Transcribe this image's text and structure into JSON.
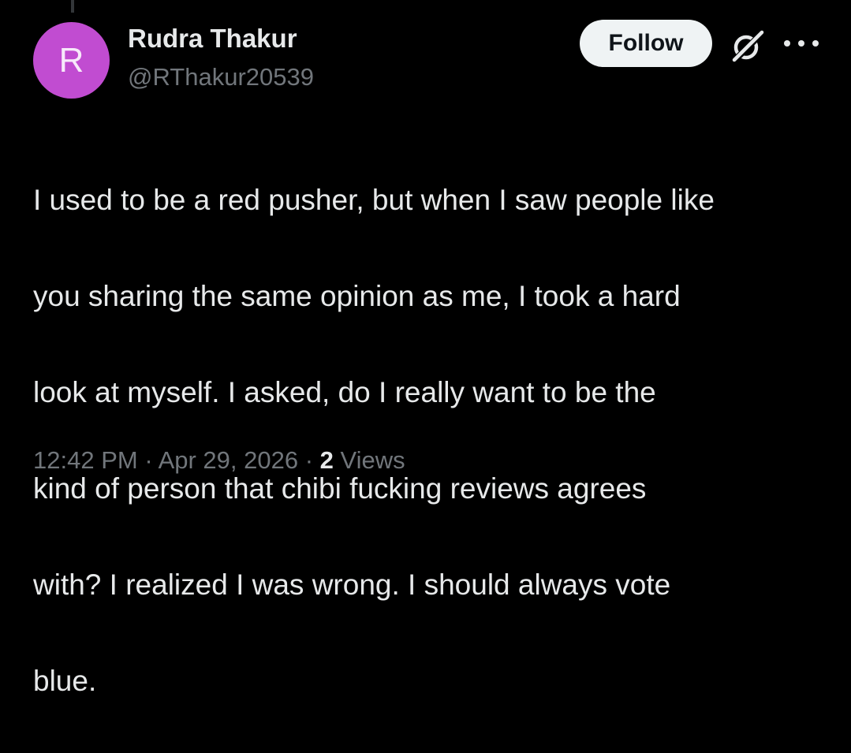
{
  "tweet": {
    "author": {
      "avatar_initial": "R",
      "display_name": "Rudra Thakur",
      "handle": "@RThakur20539"
    },
    "follow_label": "Follow",
    "text_lines": [
      "I used to be a red pusher, but when I saw people like",
      "you sharing the same opinion as me, I took a hard",
      "look at myself. I asked, do I really want to be the",
      "kind of person that chibi fucking reviews agrees",
      "with? I realized I was wrong. I should always vote",
      "blue."
    ],
    "meta": {
      "time": "12:42 PM",
      "separator": "·",
      "date": "Apr 29, 2026",
      "views_count": "2",
      "views_label": "Views"
    }
  },
  "icons": {
    "grok": "grok-icon",
    "more": "more-icon"
  },
  "colors": {
    "background": "#000000",
    "text_primary": "#e7e9ea",
    "text_secondary": "#71767b",
    "avatar_bg": "#c14cd1",
    "follow_bg": "#eff3f4",
    "follow_text": "#0f1419"
  }
}
